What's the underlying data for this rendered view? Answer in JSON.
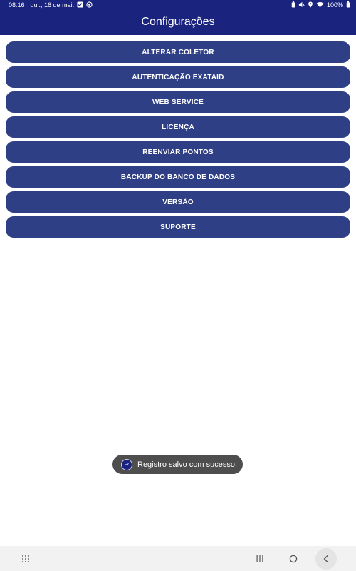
{
  "status_bar": {
    "time": "08:16",
    "date": "qui., 16 de mai.",
    "battery": "100%",
    "icons_left": [
      "check-box-icon",
      "sync-icon"
    ],
    "icons_right": [
      "battery-saver-icon",
      "mute-icon",
      "location-icon",
      "wifi-icon",
      "battery-icon"
    ]
  },
  "app_bar": {
    "title": "Configurações"
  },
  "menu": {
    "items": [
      {
        "label": "ALTERAR COLETOR"
      },
      {
        "label": "AUTENTICAÇÃO EXATAID"
      },
      {
        "label": "WEB SERVICE"
      },
      {
        "label": "LICENÇA"
      },
      {
        "label": "REENVIAR PONTOS"
      },
      {
        "label": "BACKUP DO BANCO DE DADOS"
      },
      {
        "label": "VERSÃO"
      },
      {
        "label": "SUPORTE"
      }
    ]
  },
  "toast": {
    "logo_text": "Ex",
    "message": "Registro salvo com sucesso!"
  },
  "nav_bar": {
    "icons": [
      "app-drawer-icon",
      "recent-apps-icon",
      "home-icon",
      "back-icon"
    ]
  },
  "colors": {
    "primary": "#1a237e",
    "button": "#2f3f86",
    "toast": "#4e4e4e"
  }
}
